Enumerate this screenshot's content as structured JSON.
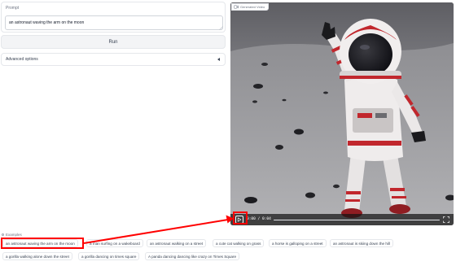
{
  "prompt": {
    "label": "Prompt",
    "value": "an astronaut waving the arm on the moon"
  },
  "run_button": {
    "label": "Run"
  },
  "advanced": {
    "label": "Advanced options"
  },
  "video": {
    "tag_label": "Generated Video",
    "time_text": "0:00 / 0:04",
    "progress": 0.0
  },
  "examples": {
    "label": "Examples",
    "items": [
      "an astronaut waving the arm on the moon",
      "a man surfing on a wakeboard",
      "an astronaut walking on a street",
      "a cute cat walking on grass",
      "a horse is galloping on a street",
      "an astronaut is skiing down the hill",
      "a gorilla walking alone down the street",
      "a gorilla dancing on times square",
      "A panda dancing dancing like crazy on Times Square"
    ]
  },
  "colors": {
    "highlight": "#ff0000",
    "annotation_arrow": "#ff0000"
  }
}
